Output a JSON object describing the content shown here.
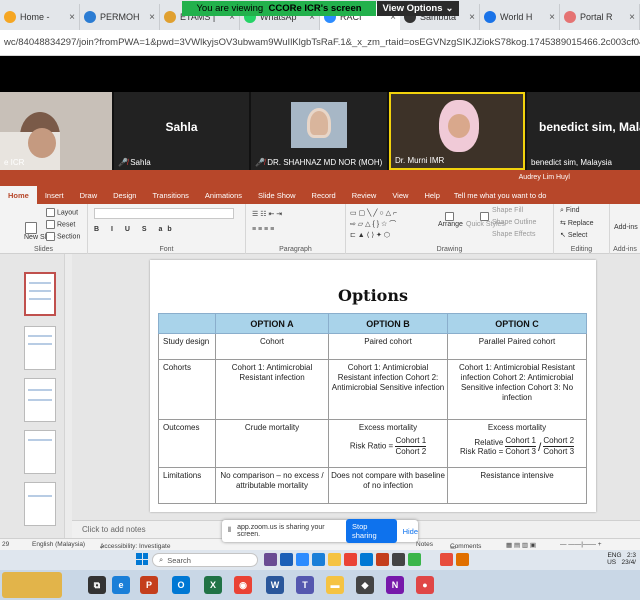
{
  "browser": {
    "tabs": [
      {
        "label": "Home -",
        "color": "#f5a623"
      },
      {
        "label": "PERMOH",
        "color": "#2b7cd3"
      },
      {
        "label": "ETAMS |",
        "color": "#e0a030"
      },
      {
        "label": "WhatsAp",
        "color": "#25d366"
      },
      {
        "label": "RACI",
        "color": "#2d8cff",
        "active": true
      },
      {
        "label": "Sambuta",
        "color": "#333333"
      },
      {
        "label": "World H",
        "color": "#1a73e8"
      },
      {
        "label": "Portal R",
        "color": "#e57373"
      }
    ],
    "address": "wc/84048834297/join?fromPWA=1&pwd=3VWlkyjsOV3ubwam9WuIlKlgbTsRaF.1&_x_zm_rtaid=osEGVNzgSIKJZiokS78kog.1745389015466.2c003cf0414f88a"
  },
  "gallery": {
    "tiles": [
      {
        "name": "e ICR",
        "big": ""
      },
      {
        "name": "Sahla",
        "big": "Sahla"
      },
      {
        "name": "DR. SHAHNAZ MD NOR (MOH)",
        "big": ""
      },
      {
        "name": "Dr. Murni IMR",
        "big": ""
      },
      {
        "name": "benedict sim, Malaysia",
        "big": "benedict sim, Malay"
      }
    ]
  },
  "zoom": {
    "viewing_prefix": "You are viewing",
    "viewing_name": "CCORe ICR's screen",
    "view_options": "View Options",
    "share_text": "app.zoom.us is sharing your screen.",
    "stop_sharing": "Stop sharing",
    "hide": "Hide"
  },
  "ppt": {
    "account": "Audrey Lim Huyl",
    "tabs": [
      "Home",
      "Insert",
      "Draw",
      "Design",
      "Transitions",
      "Animations",
      "Slide Show",
      "Record",
      "Review",
      "View",
      "Help"
    ],
    "tell_me": "Tell me what you want to do",
    "groups": {
      "slides": "Slides",
      "font": "Font",
      "paragraph": "Paragraph",
      "drawing": "Drawing",
      "editing": "Editing",
      "addins": "Add-ins"
    },
    "buttons": {
      "new_slide": "New Slide",
      "layout": "Layout",
      "reset": "Reset",
      "section": "Section",
      "arrange": "Arrange",
      "quick_styles": "Quick Styles",
      "shape_fill": "Shape Fill",
      "shape_outline": "Shape Outline",
      "shape_effects": "Shape Effects",
      "find": "Find",
      "replace": "Replace",
      "select": "Select",
      "addins": "Add-ins"
    },
    "notes_placeholder": "Click to add notes",
    "status": {
      "slide": "29",
      "language": "English (Malaysia)",
      "accessibility": "Accessibility: Investigate",
      "notes": "Notes",
      "comments": "Comments"
    }
  },
  "slide": {
    "title": "Options",
    "headers": [
      "",
      "OPTION A",
      "OPTION B",
      "OPTION C"
    ],
    "rows": [
      {
        "label": "Study design",
        "a": "Cohort",
        "b": "Paired cohort",
        "c": "Parallel Paired cohort"
      },
      {
        "label": "Cohorts",
        "a": "Cohort 1: Antimicrobial Resistant infection",
        "b": "Cohort 1: Antimicrobial Resistant infection Cohort 2: Antimicrobial Sensitive infection",
        "c": "Cohort 1: Antimicrobial Resistant infection Cohort 2: Antimicrobial Sensitive infection Cohort 3: No infection"
      },
      {
        "label": "Outcomes",
        "a": "Crude mortality",
        "b": "Excess mortality",
        "c": "Excess mortality"
      },
      {
        "label": "Limitations",
        "a": "No comparison – no excess / attributable mortality",
        "b": "Does not compare with baseline of no infection",
        "c": "Resistance intensive"
      }
    ],
    "risk_b": {
      "prefix": "Risk Ratio =",
      "num": "Cohort 1",
      "den": "Cohort 2"
    },
    "risk_c": {
      "prefix1": "Relative",
      "prefix2": "Risk Ratio =",
      "num1": "Cohort 1",
      "den1": "Cohort 3",
      "num2": "Cohort 2",
      "den2": "Cohort 3"
    }
  },
  "taskbar": {
    "search": "Search",
    "lang": "ENG",
    "region": "US",
    "time": "2:3",
    "date": "23/4/"
  }
}
